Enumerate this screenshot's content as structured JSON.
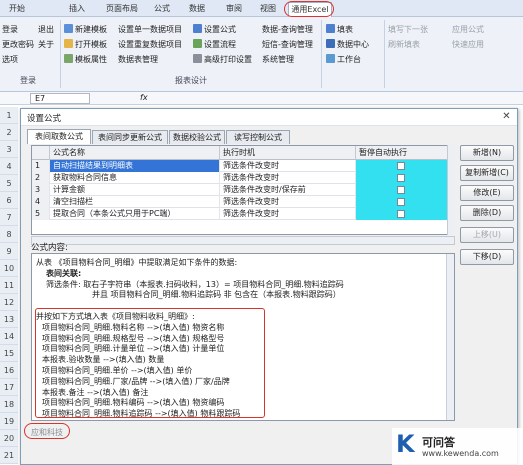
{
  "tabs": [
    "开始",
    "插入",
    "页面布局",
    "公式",
    "数据",
    "审阅",
    "视图",
    "通用Excel"
  ],
  "ribbon": {
    "col1": [
      "登录",
      "更改密码",
      "选项"
    ],
    "col1b": [
      "退出",
      "关于"
    ],
    "col2": [
      "新建模板",
      "打开模板",
      "模板属性"
    ],
    "col3": [
      "设置单一数据项目",
      "设置重复数据项目",
      "数据表管理"
    ],
    "col4": [
      "设置公式",
      "设置流程",
      "高级打印设置"
    ],
    "col5": [
      "数据-查询管理",
      "短信-查询管理",
      "系统管理"
    ],
    "col6": [
      "填表",
      "数据中心",
      "工作台"
    ],
    "col7": [
      "填写下一张",
      "刷新填表"
    ],
    "col8": [
      "应用公式",
      "快速应用"
    ],
    "groups": {
      "g1": "登录",
      "g2": "报表设计"
    }
  },
  "formula_bar": {
    "name_box": "E7",
    "fx": "fx"
  },
  "dialog": {
    "title": "设置公式",
    "tabs": [
      "表间取数公式",
      "表间同步更新公式",
      "数据校验公式",
      "读写控制公式"
    ],
    "table": {
      "headers": [
        "",
        "公式名称",
        "执行时机",
        "暂停自动执行"
      ],
      "rows": [
        {
          "idx": "1",
          "name": "自动扫描结果到明细表",
          "timing": "筛选条件改变时"
        },
        {
          "idx": "2",
          "name": "获取物料合同信息",
          "timing": "筛选条件改变时"
        },
        {
          "idx": "3",
          "name": "计算金额",
          "timing": "筛选条件改变时/保存前"
        },
        {
          "idx": "4",
          "name": "清空扫描栏",
          "timing": "筛选条件改变时"
        },
        {
          "idx": "5",
          "name": "提取合同（本条公式只用于PC端）",
          "timing": "筛选条件改变时"
        }
      ]
    },
    "buttons": [
      "新增(N)",
      "复制新增(C)",
      "修改(E)",
      "删除(D)",
      "上移(U)",
      "下移(D)"
    ],
    "formula_label": "公式内容:",
    "formula_lines": [
      {
        "t": "从表 《项目物料合同_明细》中提取满足如下条件的数据:",
        "c": ""
      },
      {
        "t": "表间关联:",
        "c": "bold",
        "indent": 10
      },
      {
        "t": "筛选条件: 取右子字符串（本报表.扫码收料，13）= 项目物料合同_明细.物料追踪码",
        "c": "",
        "indent": 10
      },
      {
        "t": "并且 项目物料合同_明细.物料追踪码 非 包含在（本报表.物料跟踪码）",
        "c": "",
        "indent": 56
      },
      {
        "t": "",
        "c": ""
      },
      {
        "t": "并按如下方式填入表《项目物料收料_明细》:",
        "c": ""
      },
      {
        "t": "项目物料合同_明细.物料名称    -->(填入值) 物资名称",
        "c": "",
        "indent": 6
      },
      {
        "t": "项目物料合同_明细.规格型号    -->(填入值) 规格型号",
        "c": "",
        "indent": 6
      },
      {
        "t": "项目物料合同_明细.计量单位    -->(填入值) 计量单位",
        "c": "",
        "indent": 6
      },
      {
        "t": "本报表.验收数量    -->(填入值) 数量",
        "c": "",
        "indent": 6
      },
      {
        "t": "项目物料合同_明细.单价    -->(填入值) 单价",
        "c": "",
        "indent": 6
      },
      {
        "t": "项目物料合同_明细.厂家/品牌    -->(填入值) 厂家/品牌",
        "c": "",
        "indent": 6
      },
      {
        "t": "本报表.备注    -->(填入值) 备注",
        "c": "",
        "indent": 6
      },
      {
        "t": "项目物料合同_明细.物料编码    -->(填入值) 物资编码",
        "c": "",
        "indent": 6
      },
      {
        "t": "项目物料合同_明细.物料追踪码    -->(填入值) 物料跟踪码",
        "c": "",
        "indent": 6
      }
    ],
    "footer": "应和科技"
  },
  "rows": [
    "1",
    "2",
    "3",
    "4",
    "5",
    "6",
    "7",
    "8",
    "9",
    "10",
    "11",
    "12",
    "13",
    "14",
    "15",
    "16",
    "17",
    "18",
    "19",
    "20",
    "21"
  ],
  "watermark": {
    "brand": "可问答",
    "url": "www.kewenda.com",
    "logo": "K"
  },
  "colors": {
    "accent": "#1b3fc4",
    "highlight": "#33e0f0",
    "select": "#3374d6",
    "red": "#d9342b"
  }
}
